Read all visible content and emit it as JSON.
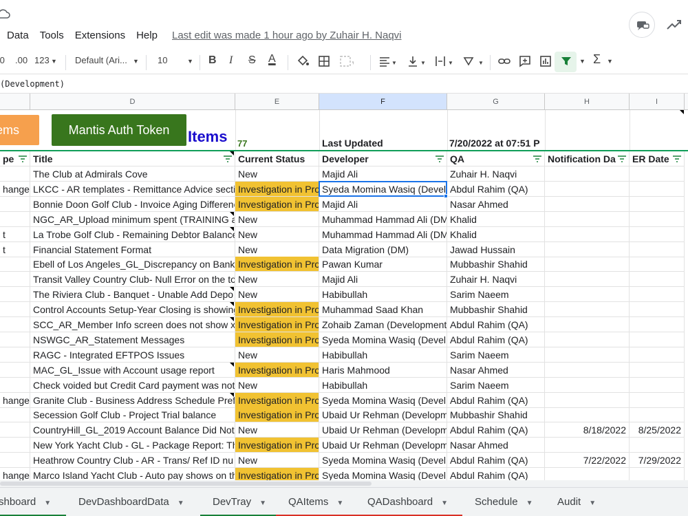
{
  "menu": {
    "items": [
      "Data",
      "Tools",
      "Extensions",
      "Help"
    ],
    "last_edit": "Last edit was made 1 hour ago by Zuhair H. Naqvi"
  },
  "toolbar": {
    "decrease_decimal": ".0",
    "increase_decimal": ".00",
    "format_more": "123",
    "font": "Default (Ari...",
    "font_size": "10",
    "bold": "B",
    "italic": "I",
    "strike": "S",
    "text_color": "A",
    "function": "Σ"
  },
  "formula_bar": {
    "content": "(Development)"
  },
  "columns": [
    {
      "id": "D",
      "label": "D"
    },
    {
      "id": "E",
      "label": "E"
    },
    {
      "id": "F",
      "label": "F"
    },
    {
      "id": "G",
      "label": "G"
    },
    {
      "id": "H",
      "label": "H"
    },
    {
      "id": "I",
      "label": "I"
    }
  ],
  "banner": {
    "items_button": "ems",
    "mantis_button": "Mantis Auth Token",
    "items_title": "Items",
    "count": "77",
    "last_updated_label": "Last Updated",
    "last_updated_value": "7/20/2022 at  07:51  P"
  },
  "headers": {
    "type": "pe",
    "title": "Title",
    "status": "Current Status",
    "developer": "Developer",
    "qa": "QA",
    "notification": "Notification Da",
    "er_date": "ER Date"
  },
  "rows": [
    {
      "type": "",
      "title": "The Club at Admirals Cove",
      "status": "New",
      "developer": "Majid Ali",
      "qa": "Zuhair H. Naqvi",
      "notif": "",
      "er": ""
    },
    {
      "type": "hange",
      "title": "LKCC - AR templates - Remittance Advice secti",
      "status": "Investigation in Pro",
      "developer": "Syeda Momina Wasiq (Devel",
      "qa": "Abdul Rahim (QA)",
      "notif": "",
      "er": ""
    },
    {
      "type": "",
      "title": "Bonnie Doon Golf Club - Invoice Aging Differenc",
      "status": "Investigation in Pro",
      "developer": "Majid Ali",
      "qa": "Nasar Ahmed",
      "notif": "",
      "er": ""
    },
    {
      "type": "",
      "title": "NGC_AR_Upload minimum spent (TRAINING a",
      "status": "New",
      "developer": "Muhammad Hammad Ali (DM",
      "qa": "Khalid",
      "notif": "",
      "er": ""
    },
    {
      "type": "t",
      "title": "La Trobe Golf Club - Remaining Debtor Balance",
      "status": "New",
      "developer": "Muhammad Hammad Ali (DM",
      "qa": "Khalid",
      "notif": "",
      "er": ""
    },
    {
      "type": "t",
      "title": "Financial Statement Format",
      "status": "New",
      "developer": "Data Migration (DM)",
      "qa": "Jawad Hussain",
      "notif": "",
      "er": ""
    },
    {
      "type": "",
      "title": "Ebell of Los Angeles_GL_Discrepancy on Bank",
      "status": "Investigation in Pro",
      "developer": "Pawan Kumar",
      "qa": "Mubbashir Shahid",
      "notif": "",
      "er": ""
    },
    {
      "type": "",
      "title": "Transit Valley Country Club- Null Error on the to",
      "status": "New",
      "developer": "Majid Ali",
      "qa": "Zuhair H. Naqvi",
      "notif": "",
      "er": ""
    },
    {
      "type": "",
      "title": "The Riviera Club - Banquet - Unable Add Depo",
      "status": "New",
      "developer": "Habibullah",
      "qa": "Sarim Naeem",
      "notif": "",
      "er": ""
    },
    {
      "type": "",
      "title": "Control Accounts Setup-Year Closing is showing",
      "status": "Investigation in Pro",
      "developer": "Muhammad Saad Khan",
      "qa": "Mubbashir Shahid",
      "notif": "",
      "er": ""
    },
    {
      "type": "",
      "title": "SCC_AR_Member Info screen does not show x",
      "status": "Investigation in Pro",
      "developer": "Zohaib Zaman (Development",
      "qa": "Abdul Rahim (QA)",
      "notif": "",
      "er": ""
    },
    {
      "type": "",
      "title": "NSWGC_AR_Statement Messages",
      "status": "Investigation in Pro",
      "developer": "Syeda Momina Wasiq (Devel",
      "qa": "Abdul Rahim (QA)",
      "notif": "",
      "er": ""
    },
    {
      "type": "",
      "title": "RAGC - Integrated EFTPOS Issues",
      "status": "New",
      "developer": "Habibullah",
      "qa": "Sarim Naeem",
      "notif": "",
      "er": ""
    },
    {
      "type": "",
      "title": "MAC_GL_Issue with Account usage report",
      "status": "Investigation in Pro",
      "developer": "Haris Mahmood",
      "qa": "Nasar Ahmed",
      "notif": "",
      "er": ""
    },
    {
      "type": "",
      "title": "Check voided but Credit Card payment was not",
      "status": "New",
      "developer": "Habibullah",
      "qa": "Sarim Naeem",
      "notif": "",
      "er": ""
    },
    {
      "type": "hange",
      "title": "Granite Club - Business Address Schedule Pref",
      "status": "Investigation in Pro",
      "developer": "Syeda Momina Wasiq (Devel",
      "qa": "Abdul Rahim (QA)",
      "notif": "",
      "er": ""
    },
    {
      "type": "",
      "title": "Secession Golf Club -  Project Trial balance",
      "status": "Investigation in Pro",
      "developer": "Ubaid Ur Rehman (Developm",
      "qa": "Mubbashir Shahid",
      "notif": "",
      "er": ""
    },
    {
      "type": "",
      "title": "CountryHill_GL_2019 Account Balance Did Not",
      "status": "New",
      "developer": "Ubaid Ur Rehman (Developm",
      "qa": "Abdul Rahim (QA)",
      "notif": "8/18/2022",
      "er": "8/25/2022"
    },
    {
      "type": "",
      "title": "New York Yacht Club - GL - Package Report: Th",
      "status": "Investigation in Pro",
      "developer": "Ubaid Ur Rehman (Developm",
      "qa": "Nasar Ahmed",
      "notif": "",
      "er": ""
    },
    {
      "type": "",
      "title": "Heathrow Country Club - AR - Trans/ Ref ID nu",
      "status": "New",
      "developer": "Syeda Momina Wasiq (Devel",
      "qa": "Abdul Rahim (QA)",
      "notif": "7/22/2022",
      "er": "7/29/2022"
    },
    {
      "type": "hange",
      "title": "Marco Island Yacht Club - Auto pay shows on th",
      "status": "Investigation in Pro",
      "developer": "Syeda Momina Wasiq (Devel",
      "qa": "Abdul Rahim (QA)",
      "notif": "",
      "er": ""
    }
  ],
  "tabs": [
    {
      "label": "shboard",
      "color": "#188038"
    },
    {
      "label": "DevDashboardData",
      "color": ""
    },
    {
      "label": "DevTray",
      "color": "#188038"
    },
    {
      "label": "QAItems",
      "color": "#d93025"
    },
    {
      "label": "QADashboard",
      "color": "#d93025"
    },
    {
      "label": "Schedule",
      "color": ""
    },
    {
      "label": "Audit",
      "color": ""
    }
  ],
  "colors": {
    "status_highlight": "#f1c232",
    "mantis_button": "#38761d",
    "items_button": "#f6a04d",
    "items_title": "#1a0dcd"
  }
}
